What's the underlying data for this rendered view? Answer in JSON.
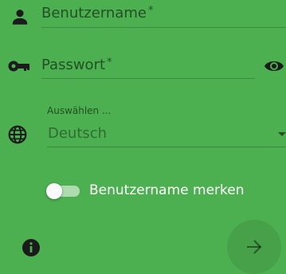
{
  "login": {
    "username": {
      "placeholder": "Benutzername",
      "required_mark": "*"
    },
    "password": {
      "placeholder": "Passwort",
      "required_mark": "*"
    },
    "language": {
      "label": "Auswählen ...",
      "value": "Deutsch"
    },
    "remember": {
      "label": "Benutzername merken",
      "checked": false
    },
    "icons": {
      "username": "person-icon",
      "password": "key-icon",
      "visibility": "eye-icon",
      "language": "globe-icon",
      "info": "info-icon",
      "submit": "arrow-right-icon"
    }
  },
  "colors": {
    "background": "#4caf50",
    "icon": "#1b1b1b",
    "accent_text": "#ffffff"
  }
}
